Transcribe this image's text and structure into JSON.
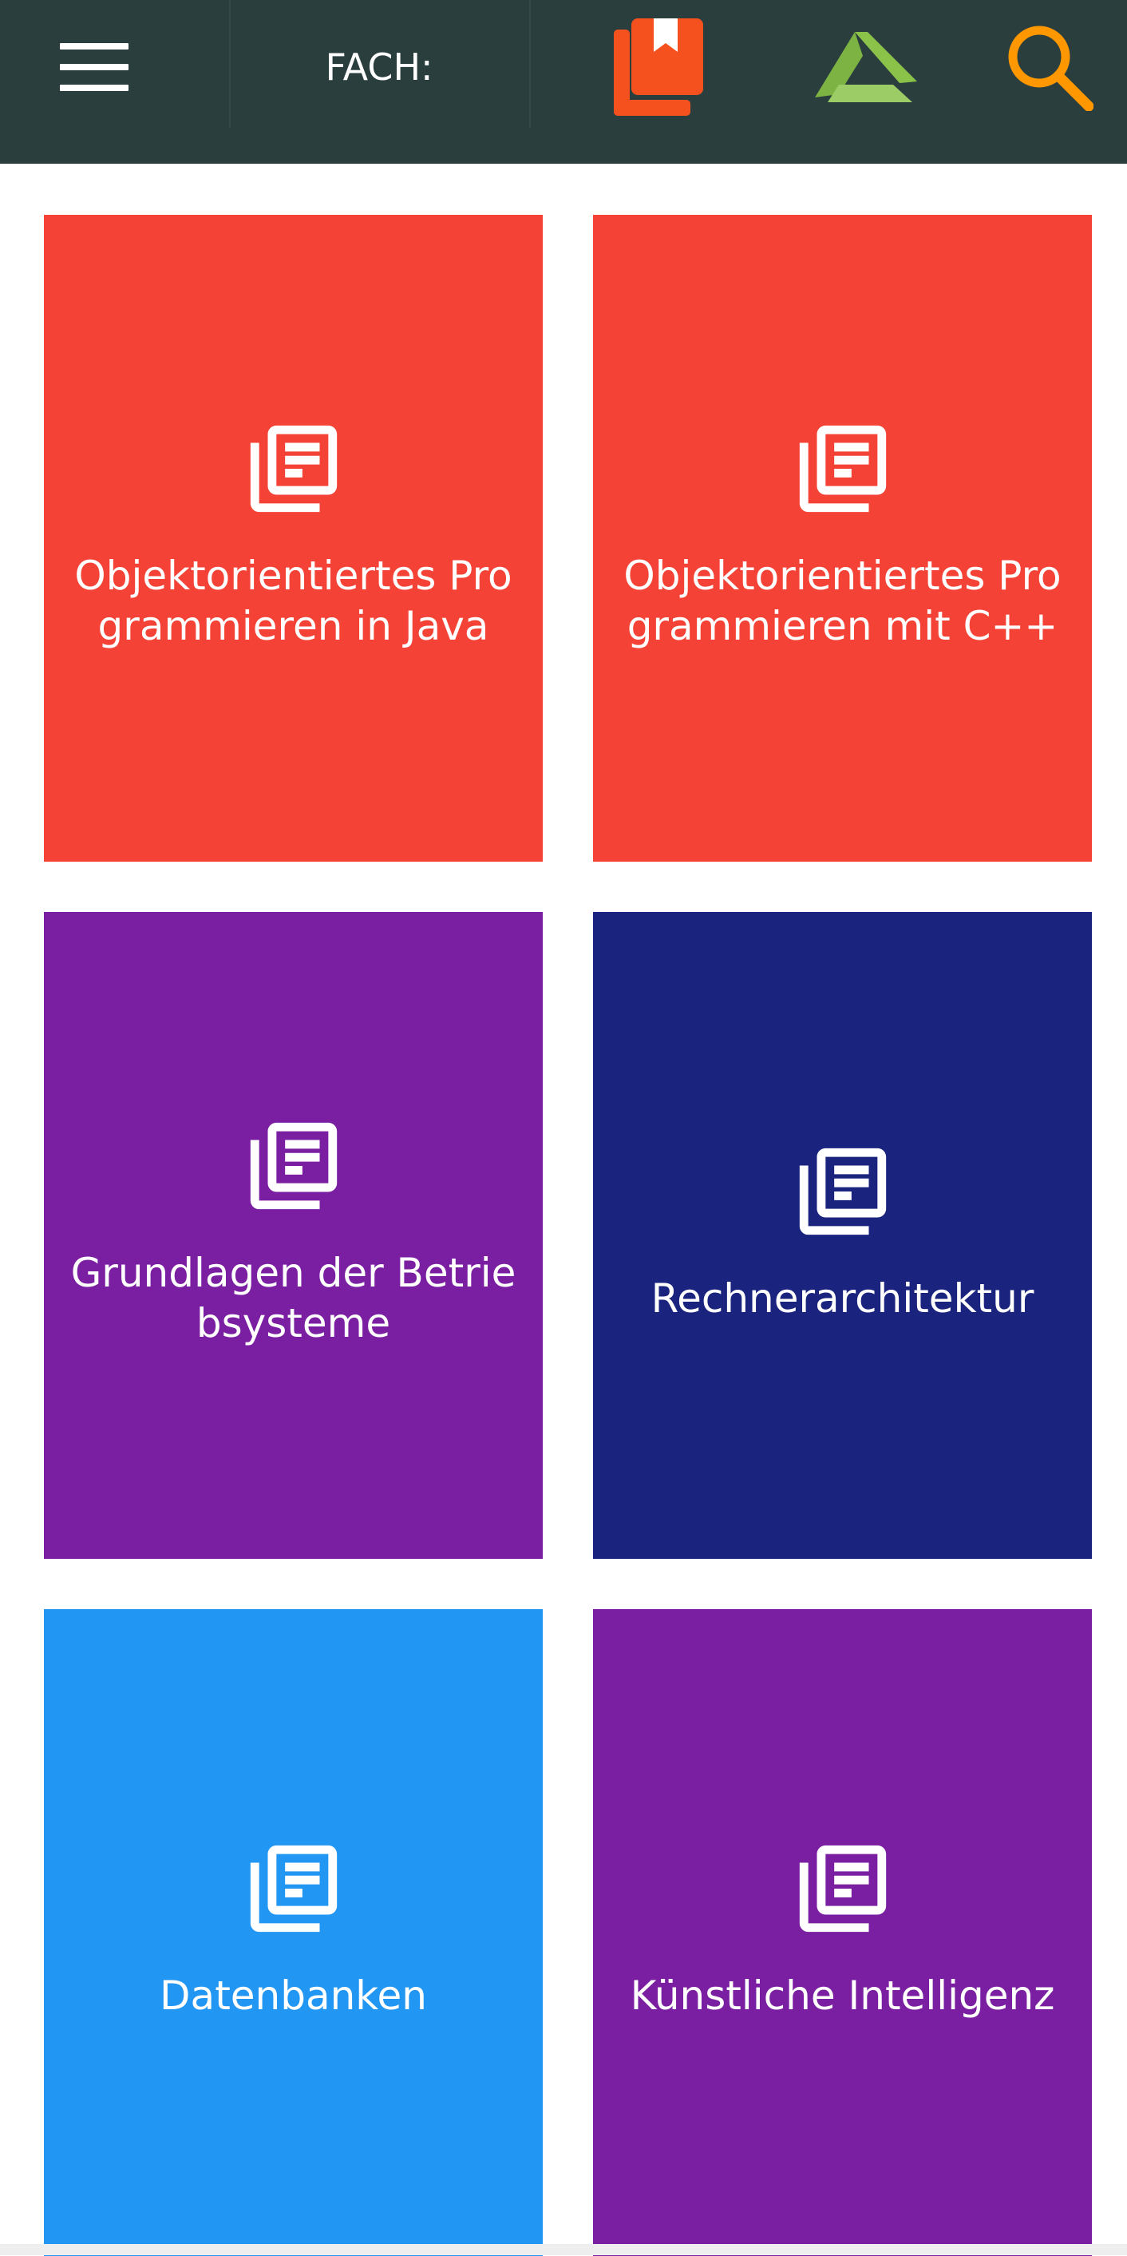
{
  "header": {
    "title": "FACH:",
    "icons": {
      "menu": "hamburger-menu-icon",
      "subjects": "book-icon",
      "logo": "app-logo-icon",
      "search": "search-icon"
    },
    "colors": {
      "background": "#2b3e3e",
      "book": "#f4511e",
      "logo": "#8bc34a",
      "search": "#ff9800"
    }
  },
  "subjects": [
    {
      "label": "Objektorientiertes Programmieren in Java",
      "color": "#f44336",
      "icon": "document-list-icon"
    },
    {
      "label": "Objektorientiertes Programmieren mit C++",
      "color": "#f44336",
      "icon": "document-list-icon"
    },
    {
      "label": "Grundlagen der Betriebsysteme",
      "color": "#7b1fa2",
      "icon": "document-list-icon"
    },
    {
      "label": "Rechnerarchitektur",
      "color": "#1a237e",
      "icon": "document-list-icon"
    },
    {
      "label": "Datenbanken",
      "color": "#2196f3",
      "icon": "document-list-icon"
    },
    {
      "label": "Künstliche Intelligenz",
      "color": "#7b1fa2",
      "icon": "document-list-icon"
    }
  ]
}
